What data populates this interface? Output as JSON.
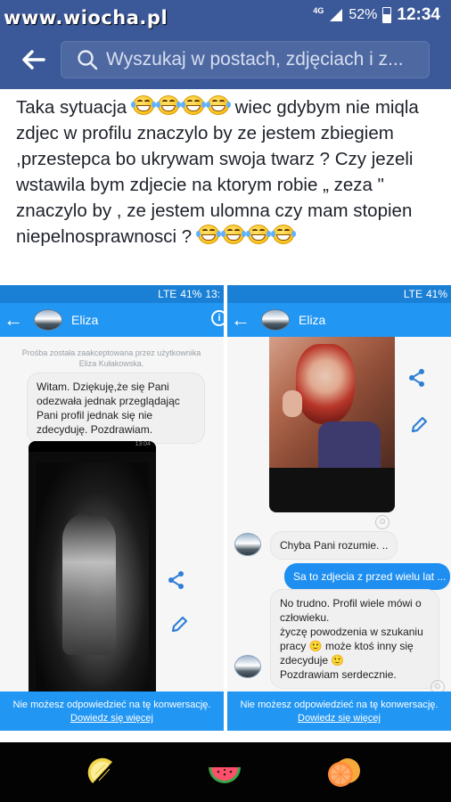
{
  "status_bar": {
    "watermark": "www.wiocha.pl",
    "network": "4G",
    "battery": "52%",
    "time": "12:34"
  },
  "search": {
    "placeholder": "Wyszukaj w postach, zdjęciach i z..."
  },
  "post": {
    "text_1": "Taka sytuacja ",
    "text_2": " wiec gdybym nie miqla zdjec w profilu znaczylo by ze jestem zbiegiem ,przestepca bo ukrywam swoja twarz ? Czy jezeli wstawila bym zdjecie na ktorym robie „ zeza \" znaczylo by , ze jestem ulomna czy mam stopien niepelnosprawnosci ? ",
    "emoji": "tears-of-joy-icon"
  },
  "left_screenshot": {
    "status": "41%",
    "status_time": "13:",
    "network": "LTE",
    "contact": "Eliza",
    "request_note": "Prośba została zaakceptowana przez użytkownika Eliza Kułakowska.",
    "message": "Witam.  Dziękuję,że się Pani odezwała jednak przeglądając Pani profil jednak się nie zdecyduję.  Pozdrawiam.",
    "photo_status": "13:04",
    "footer_text": "Nie możesz odpowiedzieć na tę konwersację.",
    "footer_link": "Dowiedz się więcej"
  },
  "right_screenshot": {
    "status": "41%",
    "network": "LTE",
    "contact": "Eliza",
    "msg_1": "Chyba Pani rozumie. ..",
    "msg_sent": "Sa to zdjecia z przed wielu lat ...",
    "msg_2": "No trudno. Profil wiele mówi o człowieku.\n życzę powodzenia w szukaniu pracy 🙂 może ktoś inny się zdecyduje 🙂\nPozdrawiam serdecznie.",
    "footer_text": "Nie możesz odpowiedzieć na tę konwersację.",
    "footer_link": "Dowiedz się więcej"
  },
  "bottom_nav": {
    "items": [
      "lemon-icon",
      "watermelon-icon",
      "orange-icon"
    ]
  },
  "colors": {
    "fb_blue": "#3b5998",
    "messenger_blue": "#2196f3"
  }
}
